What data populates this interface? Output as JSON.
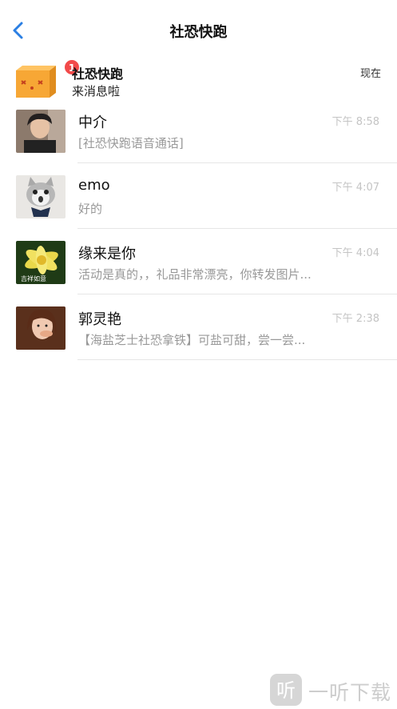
{
  "header": {
    "title": "社恐快跑"
  },
  "pinned": {
    "name": "社恐快跑",
    "message": "来消息啦",
    "time": "现在",
    "badge": "1"
  },
  "chats": [
    {
      "name": "中介",
      "message": "[社恐快跑语音通话]",
      "time": "下午 8:58"
    },
    {
      "name": "emo",
      "message": "好的",
      "time": "下午 4:07"
    },
    {
      "name": "缘来是你",
      "message": "活动是真的，，礼品非常漂亮，你转发图片...",
      "time": "下午 4:04",
      "avatar_caption": "吉祥如意"
    },
    {
      "name": "郭灵艳",
      "message": "【海盐芝士社恐拿铁】可盐可甜，尝一尝...",
      "time": "下午 2:38"
    }
  ],
  "watermark": {
    "text": "一听下载",
    "icon_glyph": "听"
  },
  "colors": {
    "accent": "#2b7fe3",
    "badge": "#f24a4a",
    "avatar_orange": "#f7a735"
  }
}
